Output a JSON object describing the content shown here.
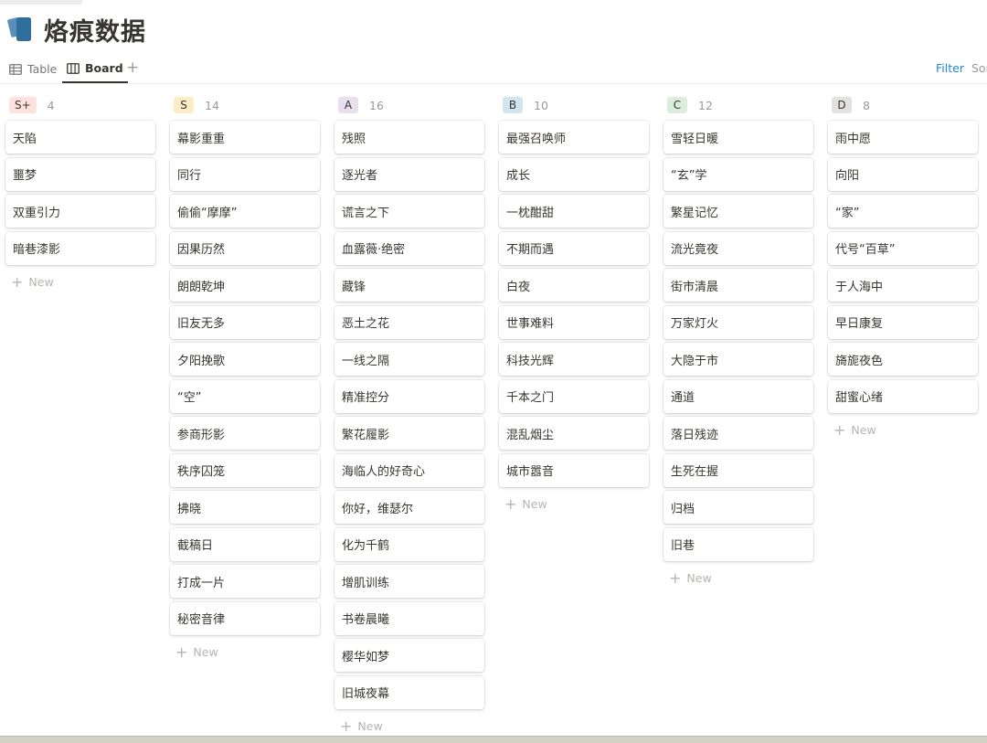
{
  "page": {
    "title": "烙痕数据",
    "icon": "stacked-cards-icon"
  },
  "views": {
    "tabs": [
      {
        "label": "Table",
        "icon": "table-icon",
        "active": false
      },
      {
        "label": "Board",
        "icon": "board-icon",
        "active": true
      }
    ],
    "add_icon": "plus-icon",
    "filter_label": "Filter",
    "sort_label": "Sor"
  },
  "colors": {
    "accent": "#2383e2",
    "badge_splus": "#ffe2dd",
    "badge_s": "#fdecc8",
    "badge_a": "#e8deee",
    "badge_b": "#d3e5ef",
    "badge_c": "#dbeddb",
    "badge_d": "#e3e2e0"
  },
  "board": {
    "new_label": "New",
    "columns": [
      {
        "tag": "S+",
        "count": "4",
        "color": "#ffe2dd",
        "cards": [
          "天陷",
          "噩梦",
          "双重引力",
          "暗巷漆影"
        ]
      },
      {
        "tag": "S",
        "count": "14",
        "color": "#fdecc8",
        "cards": [
          "幕影重重",
          "同行",
          "偷偷“摩摩”",
          "因果历然",
          "朗朗乾坤",
          "旧友无多",
          "夕阳挽歌",
          "“空”",
          "参商形影",
          "秩序囚笼",
          "拂晓",
          "截稿日",
          "打成一片",
          "秘密音律"
        ]
      },
      {
        "tag": "A",
        "count": "16",
        "color": "#e8deee",
        "cards": [
          "残照",
          "逐光者",
          "谎言之下",
          "血露薇·绝密",
          "藏锋",
          "恶土之花",
          "一线之隔",
          "精准控分",
          "繁花履影",
          "海临人的好奇心",
          "你好，维瑟尔",
          "化为千鹤",
          "增肌训练",
          "书卷晨曦",
          "樱华如梦",
          "旧城夜幕"
        ]
      },
      {
        "tag": "B",
        "count": "10",
        "color": "#d3e5ef",
        "cards": [
          "最强召唤师",
          "成长",
          "一枕酣甜",
          "不期而遇",
          "白夜",
          "世事难料",
          "科技光辉",
          "千本之门",
          "混乱烟尘",
          "城市嚣音"
        ]
      },
      {
        "tag": "C",
        "count": "12",
        "color": "#dbeddb",
        "cards": [
          "雪轻日暖",
          "“玄”学",
          "繁星记忆",
          "流光竟夜",
          "街市清晨",
          "万家灯火",
          "大隐于市",
          "通道",
          "落日残迹",
          "生死在握",
          "归档",
          "旧巷"
        ]
      },
      {
        "tag": "D",
        "count": "8",
        "color": "#e3e2e0",
        "cards": [
          "雨中愿",
          "向阳",
          "“家”",
          "代号“百草”",
          "于人海中",
          "早日康复",
          "旖旎夜色",
          "甜蜜心绪"
        ]
      }
    ]
  }
}
